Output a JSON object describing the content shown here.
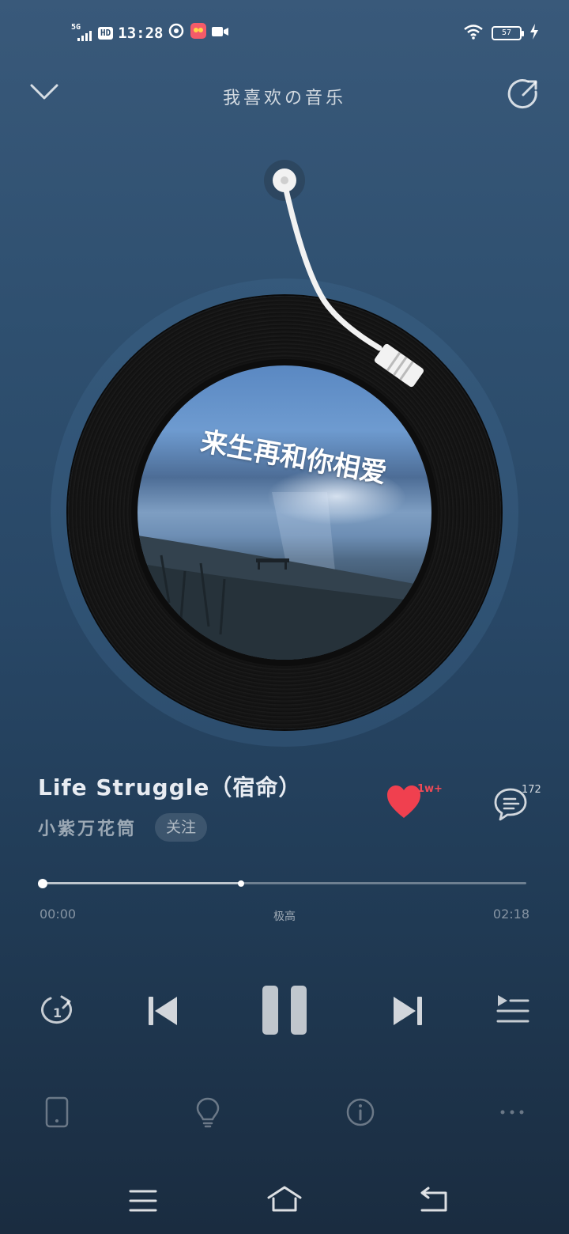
{
  "status_bar": {
    "network": "5G",
    "hd_badge": "HD",
    "time": "13:28",
    "battery": "57"
  },
  "header": {
    "title": "我喜欢の音乐"
  },
  "album": {
    "art_text": "来生再和你相爱"
  },
  "song": {
    "title": "Life Struggle（宿命）",
    "artist": "小紫万花筒",
    "follow_label": "关注",
    "like_count": "1w+",
    "comment_count": "172",
    "liked": true
  },
  "playback": {
    "current_time": "00:00",
    "total_time": "02:18",
    "quality": "极高",
    "progress": 0.0,
    "buffered": 0.41,
    "state": "playing"
  },
  "colors": {
    "like": "#f0404f",
    "accent_text": "#e8ecf2"
  },
  "icons": {
    "collapse": "chevron-down-icon",
    "share": "share-icon",
    "repeat": "repeat-one-icon",
    "prev": "skip-previous-icon",
    "pause": "pause-icon",
    "next": "skip-next-icon",
    "playlist": "playlist-icon",
    "device": "phone-device-icon",
    "lightbulb": "lightbulb-icon",
    "info": "info-icon",
    "more": "more-horizontal-icon",
    "nav_menu": "menu-icon",
    "nav_home": "home-icon",
    "nav_back": "back-icon"
  }
}
